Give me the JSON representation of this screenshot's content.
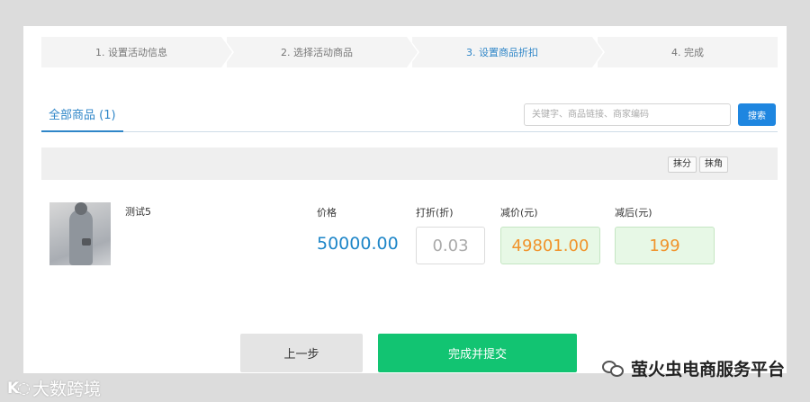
{
  "steps": [
    {
      "label": "1. 设置活动信息",
      "active": false
    },
    {
      "label": "2. 选择活动商品",
      "active": false
    },
    {
      "label": "3. 设置商品折扣",
      "active": true
    },
    {
      "label": "4. 完成",
      "active": false
    }
  ],
  "tabs": {
    "all_products": "全部商品 (1)"
  },
  "search": {
    "placeholder": "关键字、商品链接、商家编码",
    "button": "搜索"
  },
  "bulk": {
    "round_cents": "抹分",
    "round_jiao": "抹角"
  },
  "columns": {
    "price": "价格",
    "discount": "打折(折)",
    "reduce": "减价(元)",
    "after": "减后(元)"
  },
  "product": {
    "name": "测试5",
    "price": "50000.00",
    "discount": "0.03",
    "reduce": "49801.00",
    "after": "199"
  },
  "footer": {
    "prev": "上一步",
    "submit": "完成并提交"
  },
  "watermarks": {
    "left": "大数跨境",
    "right": "萤火虫电商服务平台"
  },
  "colors": {
    "accent": "#1e86e0",
    "submit": "#12c472",
    "value_orange": "#f0932b",
    "value_bg": "#e7f8e6"
  }
}
